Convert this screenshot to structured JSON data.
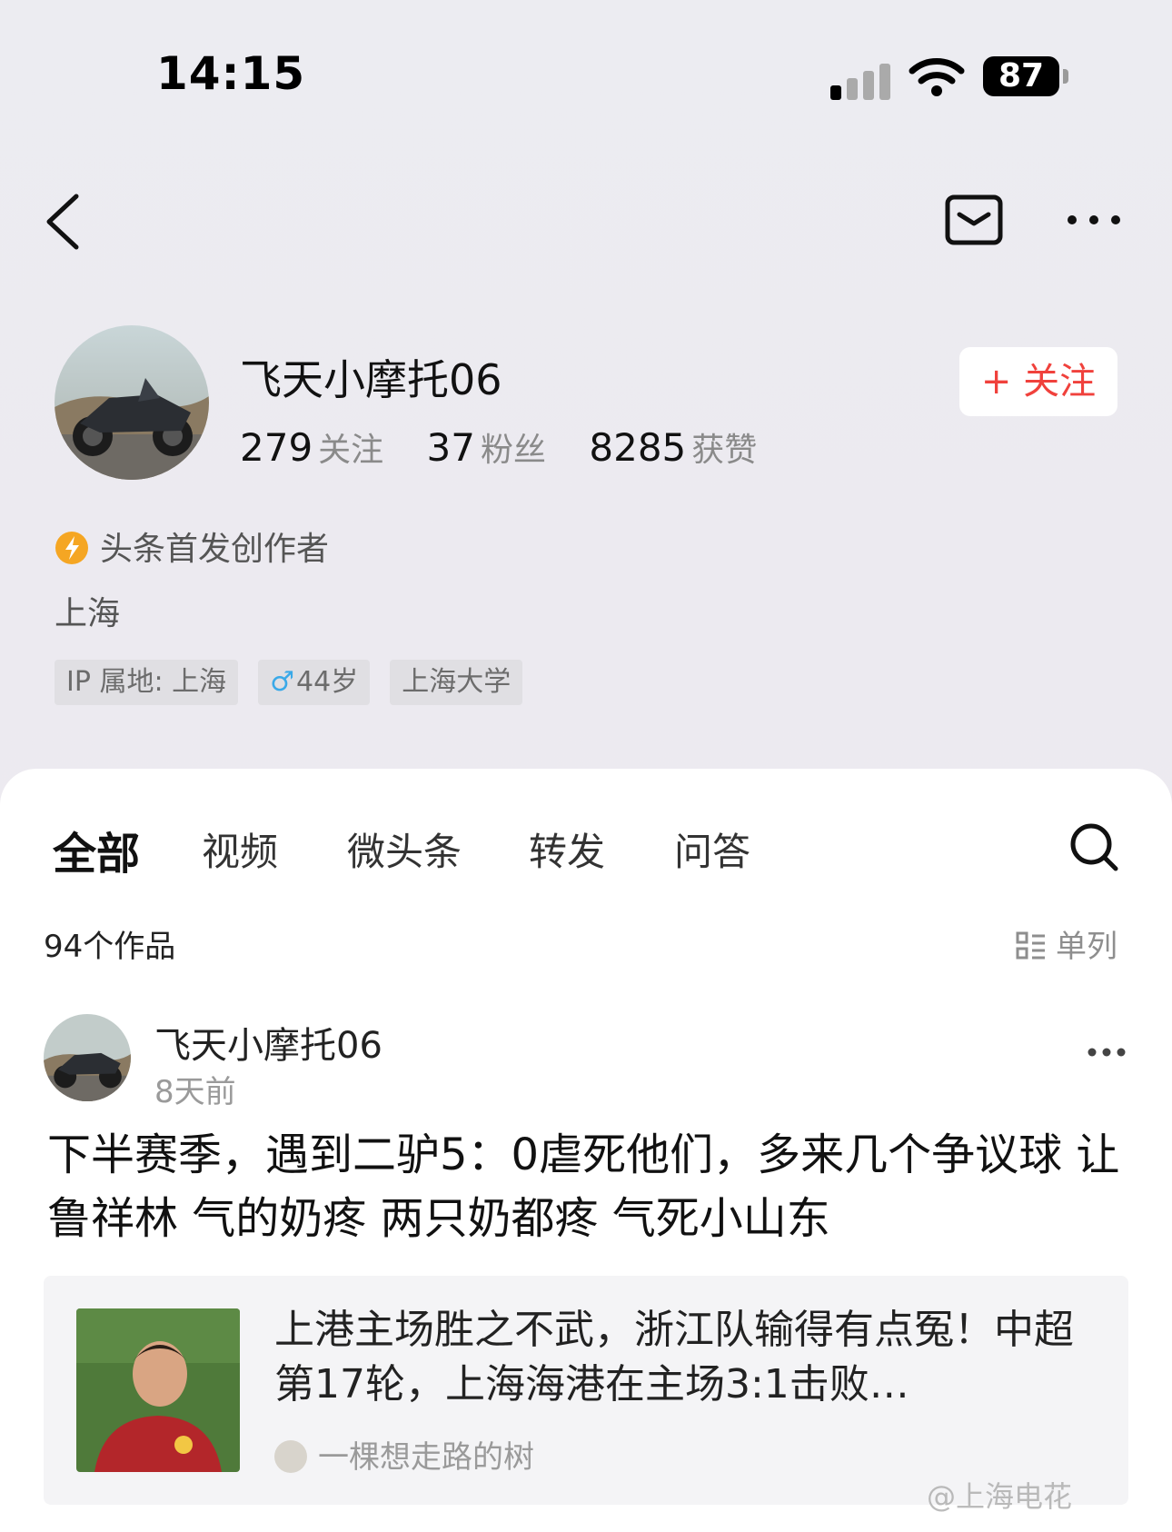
{
  "status_bar": {
    "time": "14:15",
    "battery": "87"
  },
  "profile": {
    "name": "飞天小摩托06",
    "stats": [
      {
        "value": "279",
        "label": "关注"
      },
      {
        "value": "37",
        "label": "粉丝"
      },
      {
        "value": "8285",
        "label": "获赞"
      }
    ],
    "follow_label": "+ 关注",
    "badge": "头条首发创作者",
    "city": "上海",
    "tags": {
      "ip": "IP 属地: 上海",
      "gender": "♂",
      "age": "44岁",
      "school": "上海大学"
    }
  },
  "tabs": [
    "全部",
    "视频",
    "微头条",
    "转发",
    "问答"
  ],
  "works_count": "94个作品",
  "view_toggle": "单列",
  "post": {
    "author": "飞天小摩托06",
    "time": "8天前",
    "text": "下半赛季，遇到二驴5：0虐死他们，多来几个争议球 让鲁祥林 气的奶疼 两只奶都疼 气死小山东",
    "card": {
      "title": "上港主场胜之不武，浙江队输得有点冤！中超第17轮，上海海港在主场3:1击败…",
      "author": "一棵想走路的树"
    }
  },
  "watermark": "@上海电花",
  "colors": {
    "accent": "#f0413c",
    "badge": "#f5a623"
  }
}
